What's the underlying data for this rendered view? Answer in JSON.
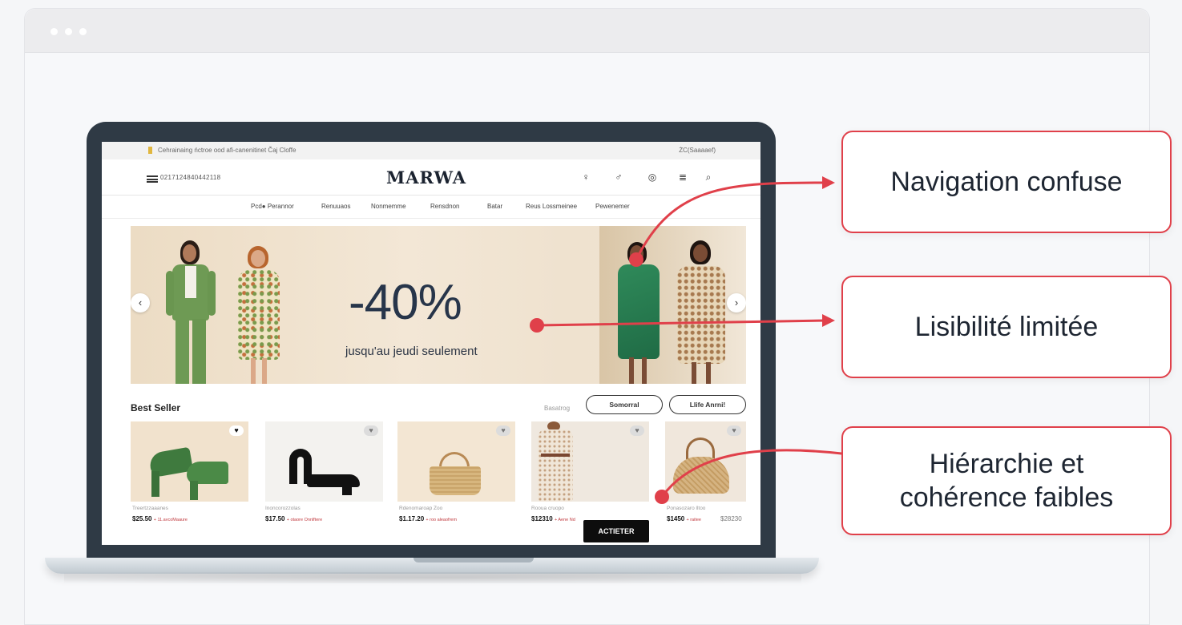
{
  "colors": {
    "accent": "#e0404a",
    "laptop": "#2f3a45",
    "heading": "#27354a"
  },
  "screen": {
    "promo_left": "Cehrainaing ńctroe ood afi-canenitinet Čaj Cloffe",
    "promo_right": "ŻC(Saaaaef)",
    "phone": "0217124840442118",
    "logo": "MARWA",
    "header_icons": [
      "account-icon",
      "account-alt-icon",
      "check-icon",
      "bag-icon",
      "search-icon"
    ],
    "nav": [
      "Pcd● Perannor",
      "Renuuaos",
      "Nonmemme",
      "Rensdnon",
      "Batar",
      "Reus Lossmeinee",
      "Pewenemer"
    ],
    "hero": {
      "percent": "-40%",
      "subtitle": "jusqu'au jeudi seulement",
      "prev": "‹",
      "next": "›"
    },
    "best_seller": {
      "title": "Best Seller",
      "small_label": "Basatrog",
      "pill_1": "Somorral",
      "pill_2": "Llife Anrni!"
    },
    "products": [
      {
        "sub": "Treertzzaaanes",
        "price": "$25.50",
        "note": "+ 11.avcoMaaure"
      },
      {
        "sub": "Inoncorozzolas",
        "price": "$17.50",
        "note": "+ otaore Onnlftere"
      },
      {
        "sub": "Rdenomaroap Zoo",
        "price": "$1.17.20",
        "note": "+ roo aleaofrem"
      },
      {
        "sub": "Rooua cruopo",
        "price": "$12310",
        "note": "+ Aene Nd"
      },
      {
        "sub": "Ponasozaro lltoo",
        "price": "$1450",
        "note": "+ raitee"
      }
    ],
    "extra_price": "$28230",
    "buy_button": "ACTIETER"
  },
  "callouts": [
    "Navigation confuse",
    "Lisibilité limitée",
    "Hiérarchie et\ncohérence faibles"
  ]
}
